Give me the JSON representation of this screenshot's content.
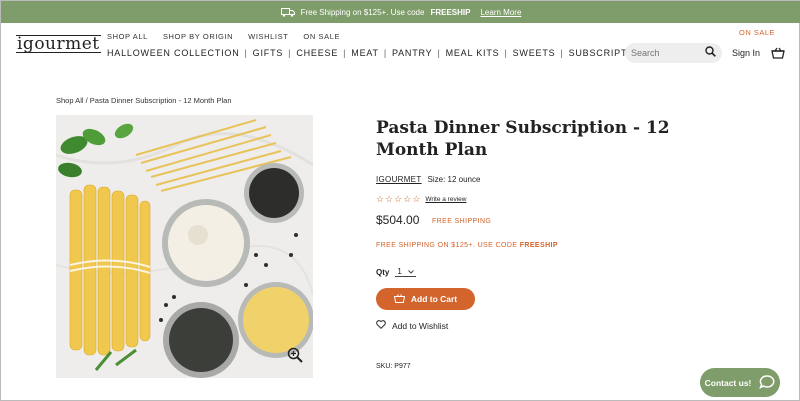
{
  "promo_bar": {
    "icon": "truck-icon",
    "text": "Free Shipping on $125+. Use code",
    "code": "FREESHIP",
    "link": "Learn More"
  },
  "header": {
    "logo": "igourmet",
    "subnav": [
      "SHOP ALL",
      "SHOP BY ORIGIN",
      "WISHLIST",
      "ON SALE"
    ],
    "mainnav": [
      "HALLOWEEN COLLECTION",
      "GIFTS",
      "CHEESE",
      "MEAT",
      "PANTRY",
      "MEAL KITS",
      "SWEETS",
      "SUBSCRIPTIONS"
    ],
    "on_sale_label": "ON SALE",
    "search_placeholder": "Search",
    "sign_in": "Sign In"
  },
  "breadcrumb": "Shop All / Pasta Dinner Subscription - 12 Month Plan",
  "product": {
    "title": "Pasta Dinner Subscription - 12 Month Plan",
    "brand": "IGOURMET",
    "size": "Size: 12 ounce",
    "rating": 0,
    "rating_max": 5,
    "write_review": "Write a review",
    "price": "$504.00",
    "shipping_badge": "FREE SHIPPING",
    "promo_text": "FREE SHIPPING ON $125+. USE CODE",
    "promo_code": "FREESHIP",
    "qty_label": "Qty",
    "qty_value": "1",
    "add_to_cart": "Add to Cart",
    "add_to_wishlist": "Add to Wishlist",
    "sku": "SKU: P977"
  },
  "contact": "Contact us!",
  "colors": {
    "brand_green": "#7f9c6b",
    "accent_orange": "#d2642c"
  }
}
